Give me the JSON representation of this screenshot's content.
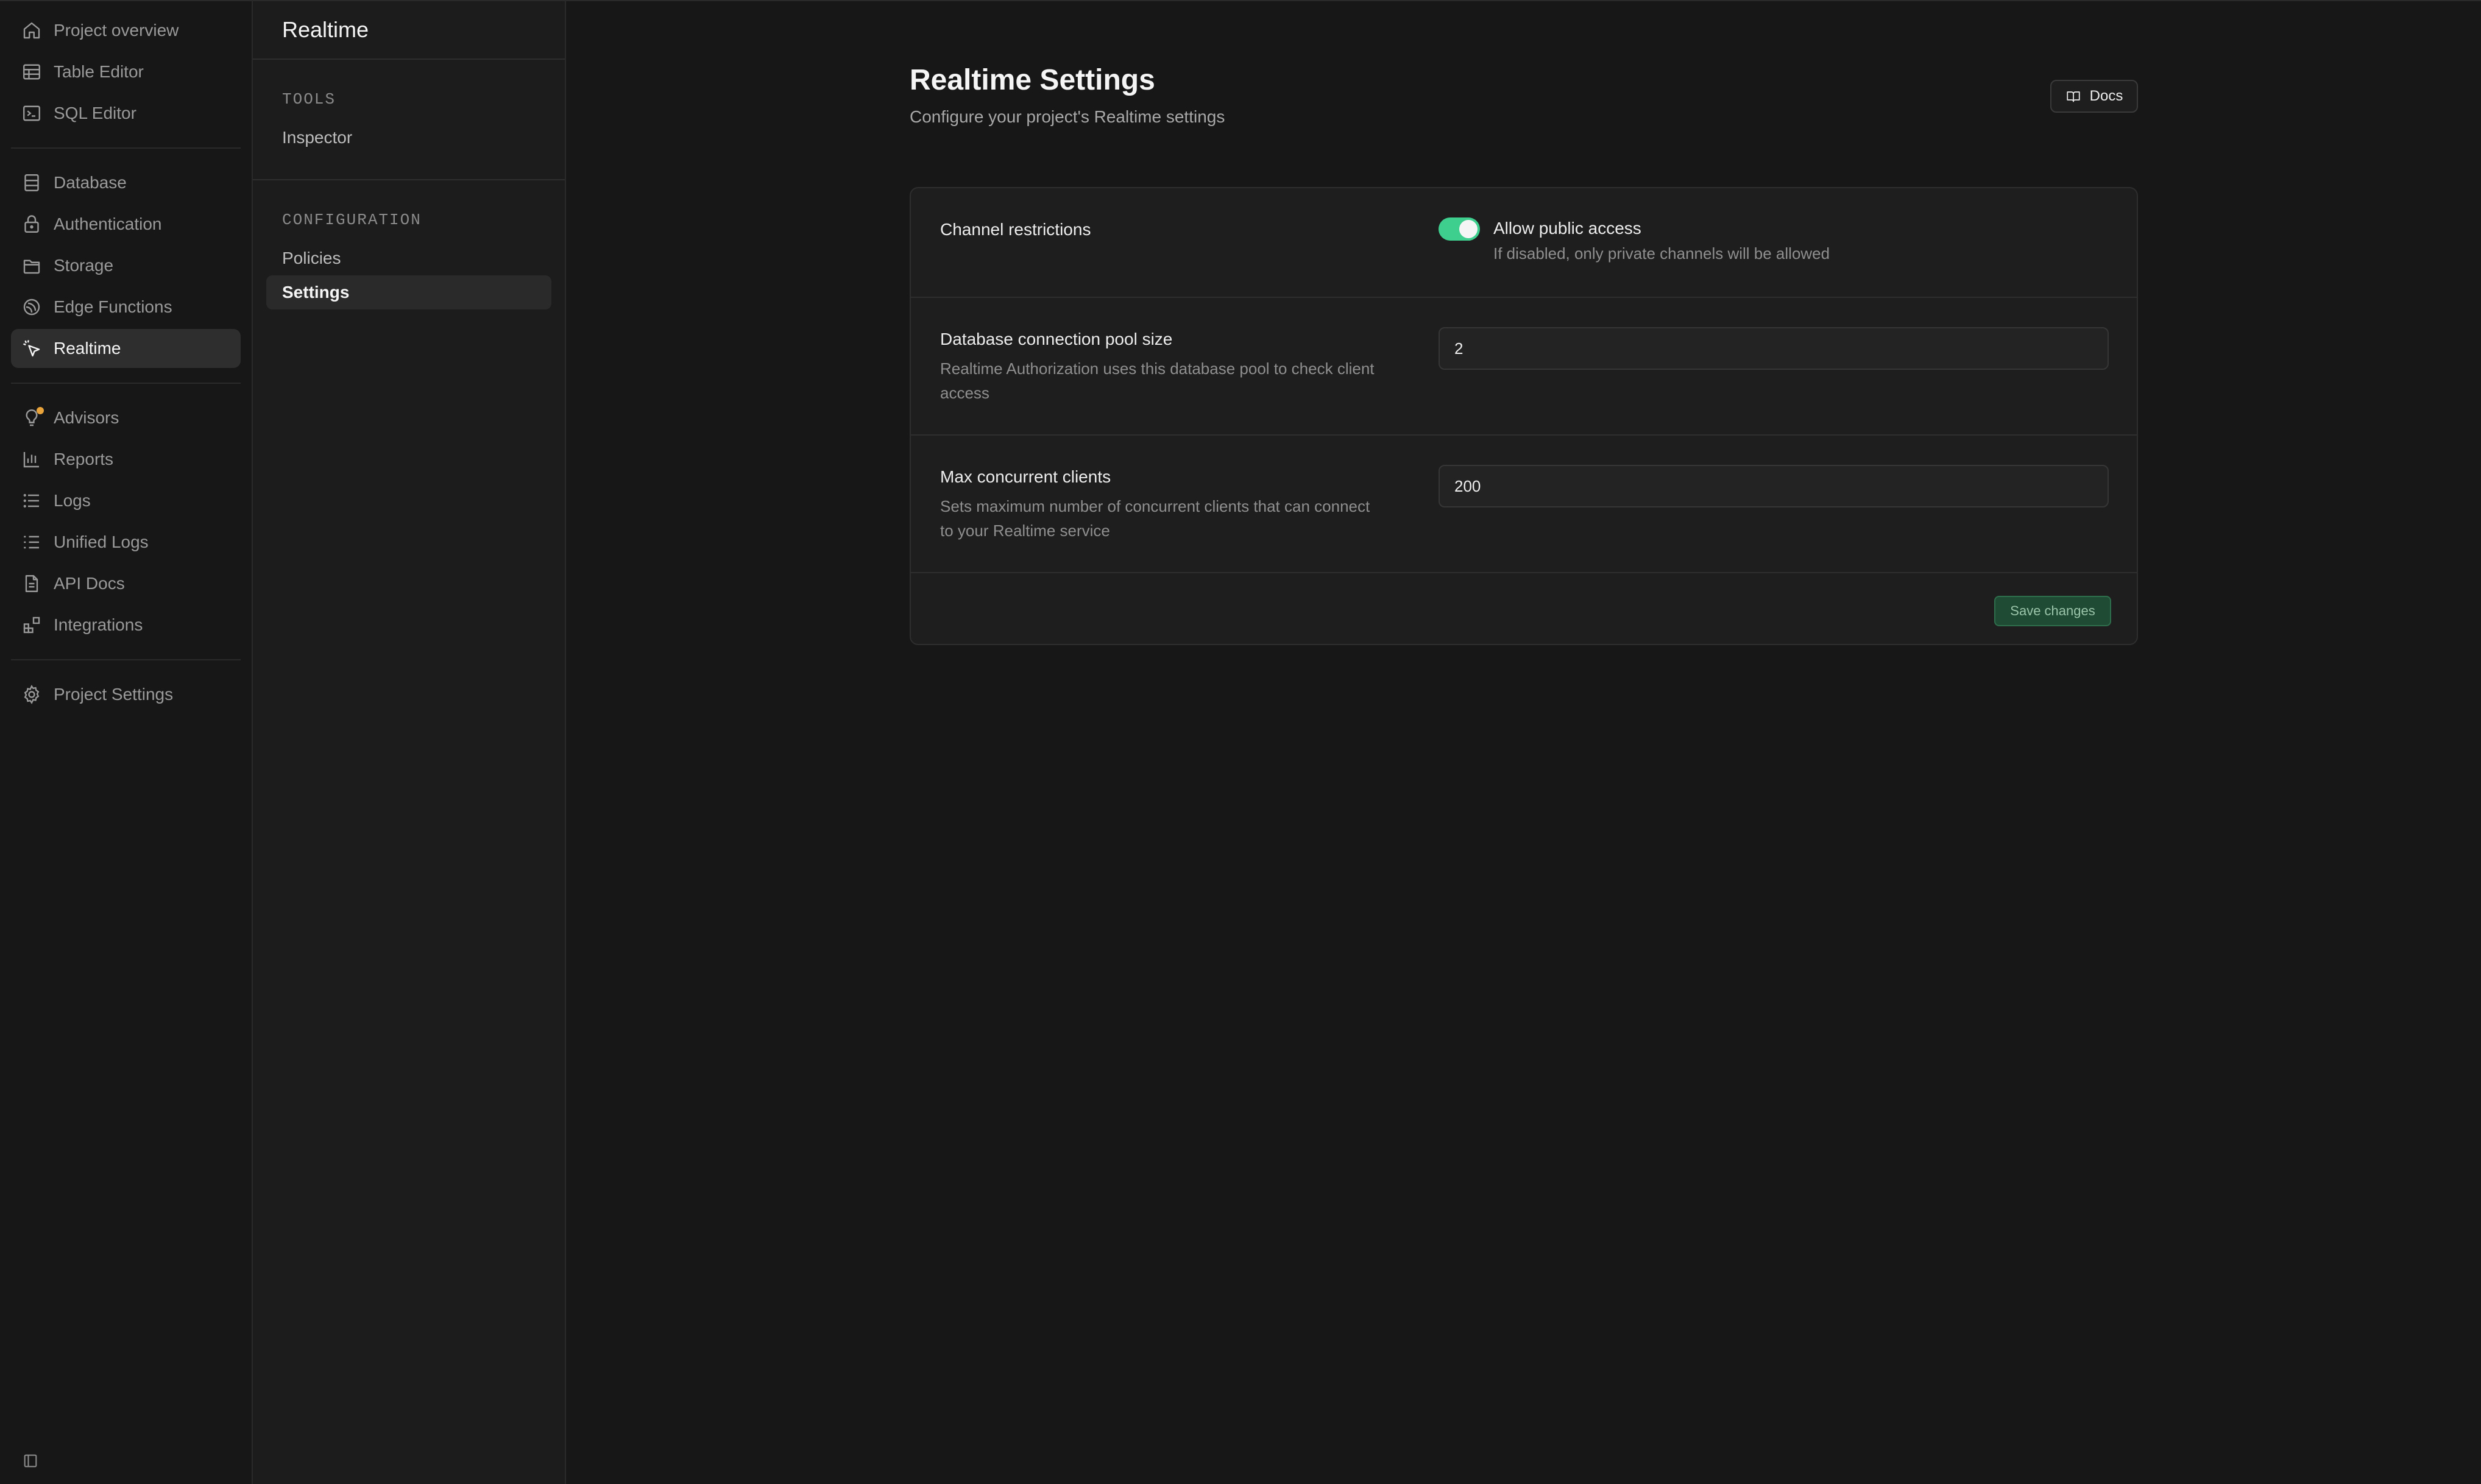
{
  "nav": {
    "items_top": [
      {
        "label": "Project overview",
        "icon": "home-icon"
      },
      {
        "label": "Table Editor",
        "icon": "table-icon"
      },
      {
        "label": "SQL Editor",
        "icon": "terminal-icon"
      }
    ],
    "items_product": [
      {
        "label": "Database",
        "icon": "database-icon"
      },
      {
        "label": "Authentication",
        "icon": "lock-icon"
      },
      {
        "label": "Storage",
        "icon": "archive-icon"
      },
      {
        "label": "Edge Functions",
        "icon": "edge-functions-icon"
      },
      {
        "label": "Realtime",
        "icon": "cursor-click-icon",
        "active": true
      }
    ],
    "items_tools": [
      {
        "label": "Advisors",
        "icon": "lightbulb-icon"
      },
      {
        "label": "Reports",
        "icon": "bar-chart-icon"
      },
      {
        "label": "Logs",
        "icon": "list-icon"
      },
      {
        "label": "Unified Logs",
        "icon": "list-dotted-icon"
      },
      {
        "label": "API Docs",
        "icon": "file-text-icon"
      },
      {
        "label": "Integrations",
        "icon": "blocks-icon"
      }
    ],
    "items_settings": [
      {
        "label": "Project Settings",
        "icon": "gear-icon"
      }
    ],
    "bottom_icon": "panel-toggle-icon"
  },
  "submenu": {
    "title": "Realtime",
    "sections": [
      {
        "title": "TOOLS",
        "items": [
          {
            "label": "Inspector"
          }
        ]
      },
      {
        "title": "CONFIGURATION",
        "items": [
          {
            "label": "Policies"
          },
          {
            "label": "Settings",
            "active": true
          }
        ]
      }
    ]
  },
  "page": {
    "title": "Realtime Settings",
    "subtitle": "Configure your project's Realtime settings",
    "docs_label": "Docs"
  },
  "settings": {
    "channel": {
      "label": "Channel restrictions",
      "toggle_label": "Allow public access",
      "toggle_desc": "If disabled, only private channels will be allowed",
      "enabled": true
    },
    "pool": {
      "label": "Database connection pool size",
      "desc": "Realtime Authorization uses this database pool to check client access",
      "value": "2"
    },
    "clients": {
      "label": "Max concurrent clients",
      "desc": "Sets maximum number of concurrent clients that can connect to your Realtime service",
      "value": "200"
    },
    "save_label": "Save changes"
  },
  "colors": {
    "accent": "#3ecf8e",
    "background": "#171717",
    "panel": "#1c1c1c",
    "card": "#1e1e1e",
    "advisor_dot": "#e8a33b"
  }
}
